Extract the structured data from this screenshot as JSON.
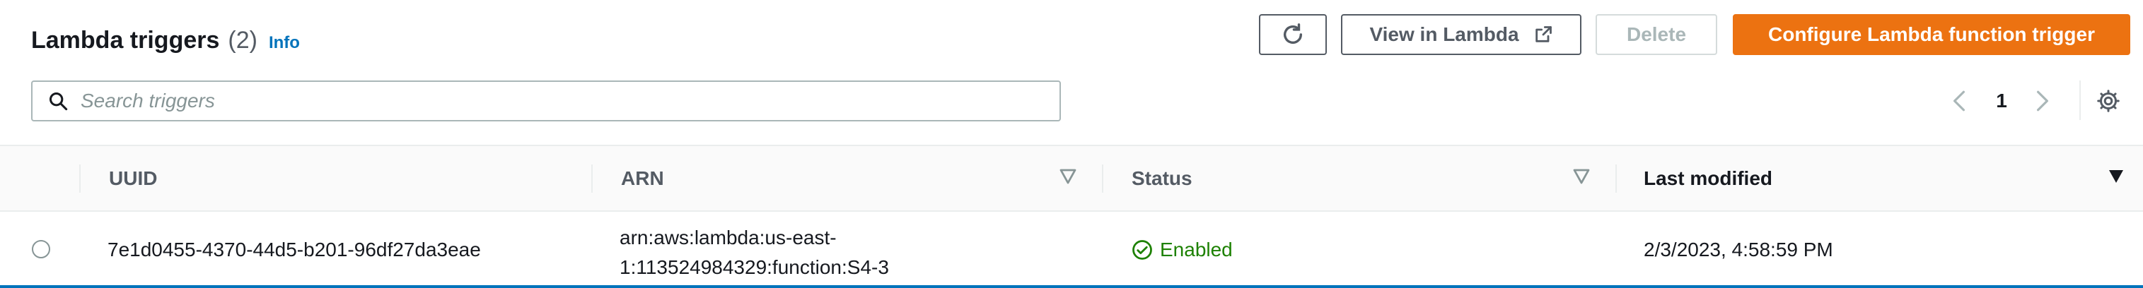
{
  "header": {
    "title": "Lambda triggers",
    "count": "(2)",
    "info_label": "Info"
  },
  "toolbar": {
    "refresh_icon": "refresh-icon",
    "view_label": "View in Lambda",
    "external_icon": "external-link-icon",
    "delete_label": "Delete",
    "configure_label": "Configure Lambda function trigger",
    "accent_color": "#ec7211"
  },
  "search": {
    "placeholder": "Search triggers",
    "icon": "search-icon"
  },
  "pagination": {
    "current_page": "1",
    "prev_icon": "chevron-left-icon",
    "next_icon": "chevron-right-icon",
    "settings_icon": "gear-icon"
  },
  "table": {
    "columns": [
      {
        "label": "UUID"
      },
      {
        "label": "ARN"
      },
      {
        "label": "Status"
      },
      {
        "label": "Last modified"
      }
    ],
    "rows": [
      {
        "uuid": "7e1d0455-4370-44d5-b201-96df27da3eae",
        "arn_line1": "arn:aws:lambda:us-east-",
        "arn_line2": "1:113524984329:function:S4-3",
        "status": "Enabled",
        "status_color": "#1d8102",
        "last_modified": "2/3/2023, 4:58:59 PM"
      }
    ]
  }
}
